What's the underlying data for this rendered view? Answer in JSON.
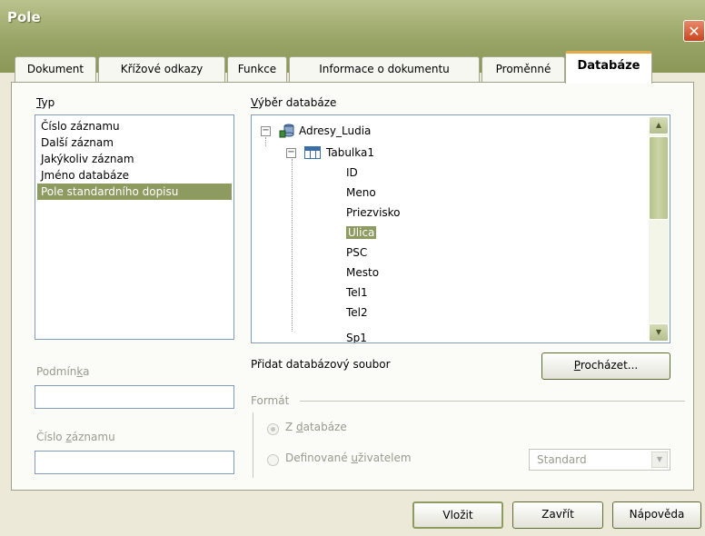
{
  "window": {
    "title": "Pole",
    "close_label": "✕"
  },
  "tabs": [
    {
      "label": "Dokument"
    },
    {
      "label": "Křížové odkazy"
    },
    {
      "label": "Funkce"
    },
    {
      "label": "Informace o dokumentu"
    },
    {
      "label": "Proměnné"
    },
    {
      "label": "Databáze",
      "active": true
    }
  ],
  "typ": {
    "label_prefix": "",
    "label_mnemonic": "T",
    "label_rest": "yp",
    "items": [
      {
        "label": "Číslo záznamu"
      },
      {
        "label": "Další záznam"
      },
      {
        "label": "Jakýkoliv záznam"
      },
      {
        "label": "Jméno databáze"
      },
      {
        "label": "Pole standardního dopisu",
        "selected": true
      }
    ]
  },
  "database": {
    "label_prefix": "",
    "label_mnemonic": "V",
    "label_rest": "ýběr databáze",
    "source": "Adresy_Ludia",
    "table": "Tabulka1",
    "fields": [
      "ID",
      "Meno",
      "Priezvisko",
      "Ulica",
      "PSC",
      "Mesto",
      "Tel1",
      "Tel2",
      "Sp1"
    ],
    "selected_field": "Ulica",
    "scroll_up": "▲",
    "scroll_down": "▼"
  },
  "condition": {
    "label_prefix": "Podmín",
    "label_mnemonic": "k",
    "label_rest": "a",
    "value": ""
  },
  "record_number": {
    "label_prefix": "Číslo ",
    "label_mnemonic": "z",
    "label_rest": "áznamu",
    "value": ""
  },
  "add_db": {
    "label": "Přidat databázový soubor",
    "browse_prefix": "",
    "browse_mnemonic": "P",
    "browse_rest": "rocházet..."
  },
  "format": {
    "legend": "Formát",
    "from_db_prefix": "Z ",
    "from_db_mnemonic": "d",
    "from_db_rest": "atabáze",
    "user_prefix": "Definované ",
    "user_mnemonic": "u",
    "user_rest": "živatelem",
    "select_value": "Standard"
  },
  "buttons": {
    "insert": "Vložit",
    "close": "Zavřít",
    "help": "Nápověda"
  }
}
